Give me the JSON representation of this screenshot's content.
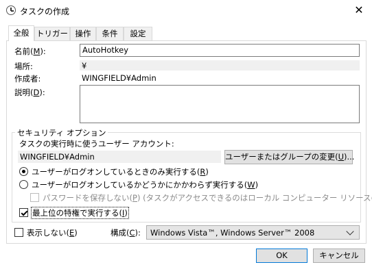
{
  "window": {
    "title": "タスクの作成",
    "close_glyph": "✕"
  },
  "tabs": [
    {
      "label": "全般"
    },
    {
      "label": "トリガー"
    },
    {
      "label": "操作"
    },
    {
      "label": "条件"
    },
    {
      "label": "設定"
    }
  ],
  "general": {
    "name_label_pre": "名前(",
    "name_label_key": "M",
    "name_label_post": "):",
    "name_value": "AutoHotkey",
    "location_label": "場所:",
    "location_value": "¥",
    "author_label": "作成者:",
    "author_value": "WINGFIELD¥Admin",
    "description_label_pre": "説明(",
    "description_label_key": "D",
    "description_label_post": "):",
    "description_value": ""
  },
  "security": {
    "group_title": "セキュリティ オプション",
    "account_prompt": "タスクの実行時に使うユーザー アカウント:",
    "account_value": "WINGFIELD¥Admin",
    "change_button_pre": "ユーザーまたはグループの変更(",
    "change_button_key": "U",
    "change_button_post": ")...",
    "radio_logged_on_pre": "ユーザーがログオンしているときのみ実行する(",
    "radio_logged_on_key": "R",
    "radio_logged_on_post": ")",
    "radio_logged_on_selected": true,
    "radio_whether_pre": "ユーザーがログオンしているかどうかにかかわらず実行する(",
    "radio_whether_key": "W",
    "radio_whether_post": ")",
    "radio_whether_selected": false,
    "no_password_pre": "パスワードを保存しない(",
    "no_password_key": "P",
    "no_password_post": ") (タスクがアクセスできるのはローカル コンピューター リソースのみ)",
    "no_password_checked": false,
    "highest_priv_pre": "最上位の特権で実行する(",
    "highest_priv_key": "I",
    "highest_priv_post": ")",
    "highest_priv_checked": true
  },
  "footer": {
    "hidden_pre": "表示しない(",
    "hidden_key": "E",
    "hidden_post": ")",
    "hidden_checked": false,
    "config_pre": "構成(",
    "config_key": "C",
    "config_post": "):",
    "config_value": "Windows Vista™, Windows Server™ 2008",
    "ok_label": "OK",
    "cancel_label": "キャンセル"
  },
  "colors": {
    "focus_blue": "#0078d7",
    "button_face": "#e1e1e1",
    "readonly_bg": "#f0f0f0"
  }
}
